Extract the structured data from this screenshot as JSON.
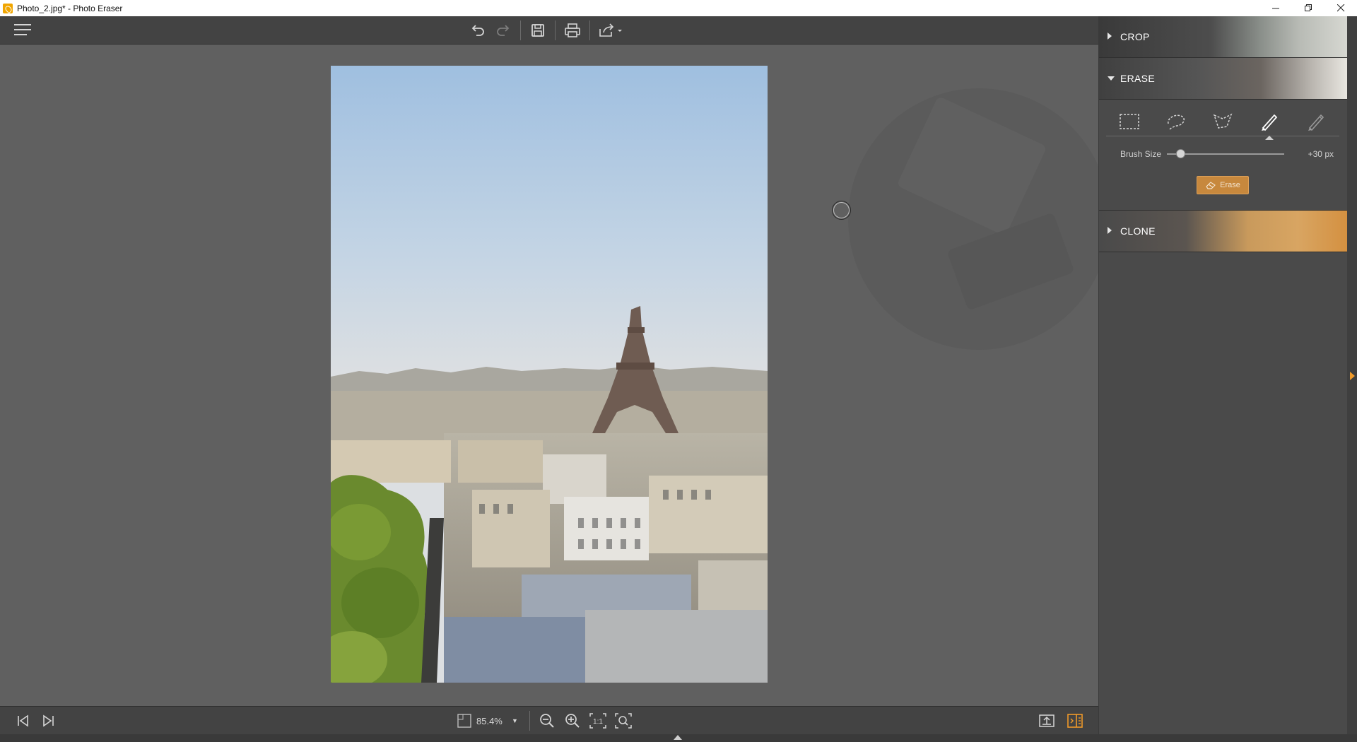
{
  "window": {
    "title": "Photo_2.jpg* - Photo Eraser",
    "controls": [
      "minimize-icon",
      "restore-icon",
      "close-icon"
    ]
  },
  "toolbar": {
    "menu_icon": "hamburger-icon",
    "buttons": [
      "undo-icon",
      "redo-icon",
      "save-icon",
      "print-icon",
      "share-icon"
    ]
  },
  "canvas": {
    "image": "Eiffel Tower Paris rooftops photo",
    "cursor": "brush-circle"
  },
  "bottom": {
    "zoom_value": "85.4%",
    "nav_buttons": [
      "first-image-icon",
      "last-image-icon"
    ],
    "zoom_buttons": [
      "zoom-out-icon",
      "zoom-in-icon",
      "actual-size-icon",
      "fit-icon"
    ],
    "view_buttons": [
      "export-icon",
      "compare-icon"
    ]
  },
  "panel": {
    "sections": {
      "crop": {
        "label": "CROP",
        "expanded": false
      },
      "erase": {
        "label": "ERASE",
        "expanded": true
      },
      "clone": {
        "label": "CLONE",
        "expanded": false
      }
    },
    "erase": {
      "tools": [
        "rectangle-select-icon",
        "lasso-icon",
        "polygon-lasso-icon",
        "brush-icon",
        "eraser-brush-icon"
      ],
      "active_tool": "brush-icon",
      "brush_size_label": "Brush Size",
      "brush_size_value": "+30 px",
      "brush_size_fraction": 0.12,
      "erase_button_label": "Erase"
    }
  },
  "colors": {
    "accent": "#c7883d",
    "toolbar": "#434343",
    "canvas": "#606060",
    "panel": "#4a4a4a"
  }
}
